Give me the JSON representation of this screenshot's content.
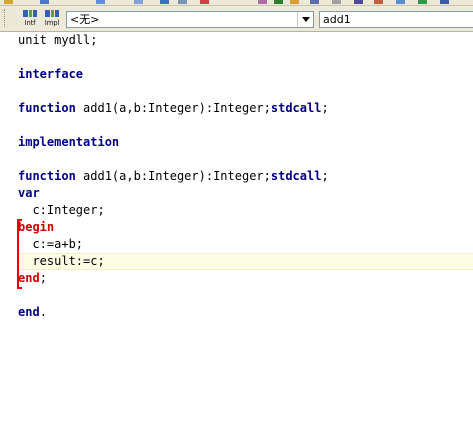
{
  "toolbar": {
    "interface_button_label": "Intf",
    "implementation_button_label": "Impl"
  },
  "nav": {
    "class_combo_value": "<无>",
    "method_combo_value": "add1"
  },
  "editor": {
    "lines": [
      {
        "kw": "",
        "text": "unit mydll;"
      },
      {
        "kw": "",
        "text": ""
      },
      {
        "kw": "interface",
        "text": ""
      },
      {
        "kw": "",
        "text": ""
      },
      {
        "kw": "function",
        "text": " add1(a,b:Integer):Integer;",
        "kw2": "stdcall",
        "tail": ";"
      },
      {
        "kw": "",
        "text": ""
      },
      {
        "kw": "implementation",
        "text": ""
      },
      {
        "kw": "",
        "text": ""
      },
      {
        "kw": "function",
        "text": " add1(a,b:Integer):Integer;",
        "kw2": "stdcall",
        "tail": ";"
      },
      {
        "kw": "var",
        "text": ""
      },
      {
        "kw": "",
        "text": "  c:Integer;"
      },
      {
        "kw": "begin",
        "text": ""
      },
      {
        "kw": "",
        "text": "  c:=a+b;"
      },
      {
        "kw": "",
        "text": "  result:=c;"
      },
      {
        "kw": "end",
        "text": ";"
      },
      {
        "kw": "",
        "text": ""
      },
      {
        "kw": "end",
        "text": "."
      }
    ]
  },
  "colors": {
    "keyword": "#000080",
    "block_marker": "#ee0000",
    "current_line": "#fdfde6"
  }
}
